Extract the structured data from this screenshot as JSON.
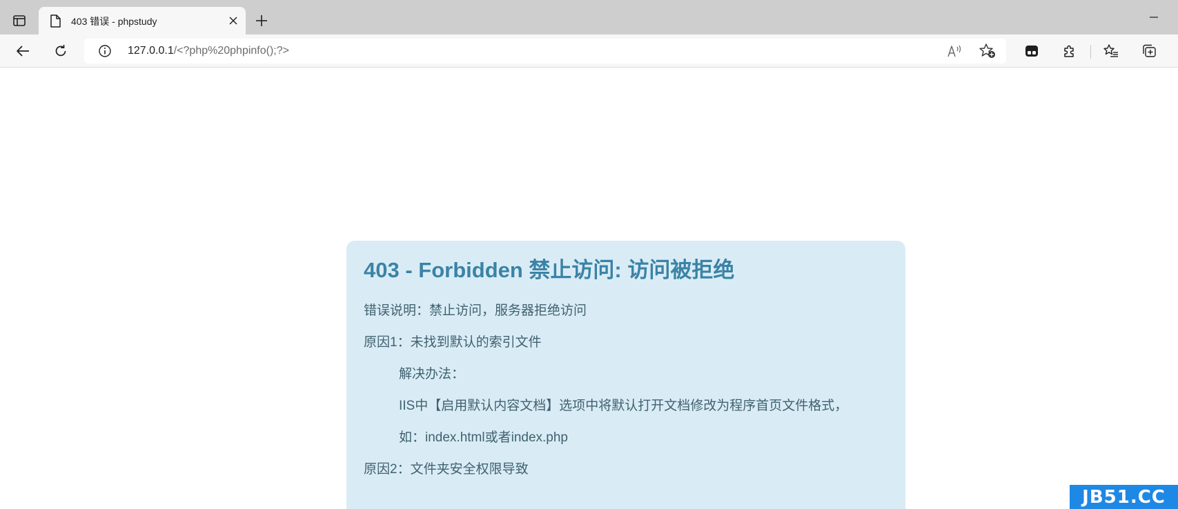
{
  "tab": {
    "title": "403 错误 - phpstudy"
  },
  "address_bar": {
    "url_host": "127.0.0.1",
    "url_path": "/<?php%20phpinfo();?>"
  },
  "page": {
    "heading": "403 - Forbidden 禁止访问: 访问被拒绝",
    "lines": [
      "错误说明：禁止访问，服务器拒绝访问",
      "原因1：未找到默认的索引文件",
      "解决办法：",
      "IIS中【启用默认内容文档】选项中将默认打开文档修改为程序首页文件格式，",
      "如：index.html或者index.php",
      "原因2：文件夹安全权限导致"
    ]
  },
  "watermark": {
    "text": "JB51.CC"
  },
  "colors": {
    "box_background": "#d9ecf5",
    "heading": "#3b83a6",
    "body_text": "#41616f",
    "watermark_bg": "#1e88e5"
  },
  "icons": {
    "tab_actions": "tab-actions-icon",
    "favicon": "document-icon",
    "close": "close-icon",
    "new_tab": "plus-icon",
    "minimize": "minimize-icon",
    "back": "back-arrow-icon",
    "refresh": "refresh-icon",
    "site_info": "info-icon",
    "read_aloud": "read-aloud-icon",
    "add_favorite": "star-add-icon",
    "extension_app": "app-icon",
    "extensions": "puzzle-icon",
    "favorites": "favorites-list-icon",
    "collections": "collections-icon"
  }
}
